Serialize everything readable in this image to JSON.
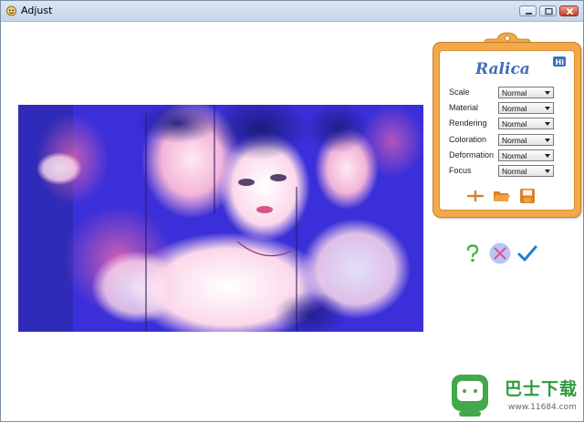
{
  "window": {
    "title": "Adjust"
  },
  "panel": {
    "logo_text": "Ralica",
    "logo_badge": "Hi",
    "settings": [
      {
        "label": "Scale",
        "value": "Normal"
      },
      {
        "label": "Material",
        "value": "Normal"
      },
      {
        "label": "Rendering",
        "value": "Normal"
      },
      {
        "label": "Coloration",
        "value": "Normal"
      },
      {
        "label": "Deformation",
        "value": "Normal"
      },
      {
        "label": "Focus",
        "value": "Normal"
      }
    ],
    "tools": [
      "add-icon",
      "folder-open-icon",
      "save-icon"
    ]
  },
  "actions": [
    "help-icon",
    "cancel-icon",
    "ok-check-icon"
  ],
  "watermark": {
    "line1": "巴士下载",
    "line2": "www.11684.com"
  },
  "colors": {
    "board": "#f3a94a",
    "check": "#1f7fd6",
    "help": "#4bb543",
    "cancel_bg": "#b9c6f5",
    "cancel_x": "#e0569a"
  }
}
